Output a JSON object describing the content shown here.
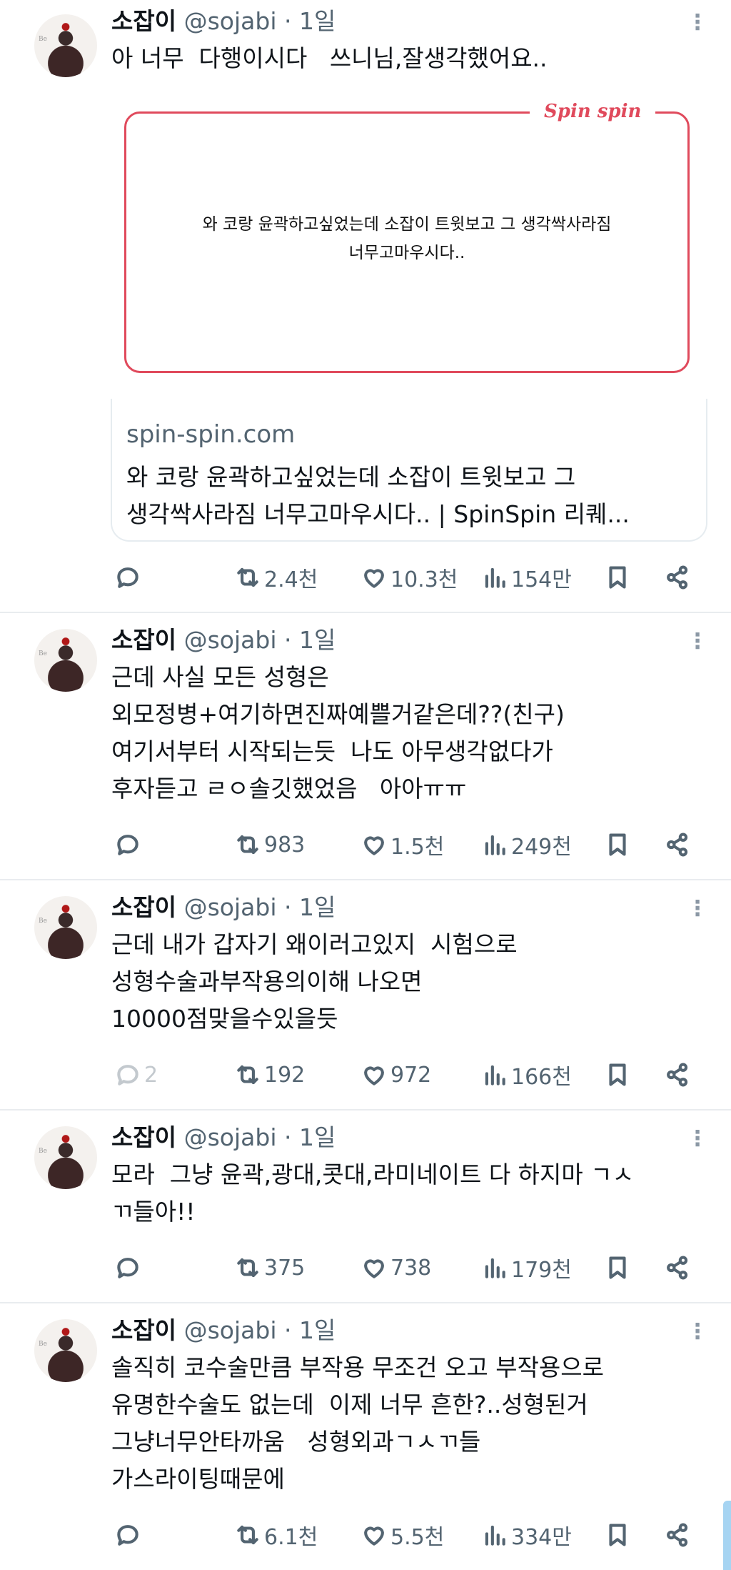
{
  "tweets": [
    {
      "name": "소잡이",
      "handle": "@sojabi",
      "time": "· 1일",
      "text": "아 너무  다행이시다   쓰니님,잘생각했어요..",
      "card": {
        "brand": "Spin spin",
        "quote_line1": "와 코랑 윤곽하고싶었는데 소잡이 트윗보고 그 생각싹사라짐",
        "quote_line2": "너무고마우시다..",
        "domain": "spin-spin.com",
        "title": "와 코랑 윤곽하고싶었는데 소잡이 트윗보고 그\n생각싹사라짐 너무고마우시다.. | SpinSpin 리퀘..."
      },
      "replies": "",
      "retweets": "2.4천",
      "likes": "10.3천",
      "views": "154만"
    },
    {
      "name": "소잡이",
      "handle": "@sojabi",
      "time": "· 1일",
      "text": "근데 사실 모든 성형은\n외모정병+여기하면진짜예쁠거같은데??(친구)\n여기서부터 시작되는듯  나도 아무생각없다가\n후자듣고 ㄹㅇ솔깃했었음   아아ㅠㅠ",
      "replies": "",
      "retweets": "983",
      "likes": "1.5천",
      "views": "249천"
    },
    {
      "name": "소잡이",
      "handle": "@sojabi",
      "time": "· 1일",
      "text": "근데 내가 갑자기 왜이러고있지  시험으로\n성형수술과부작용의이해 나오면\n10000점맞을수있을듯",
      "replies": "2",
      "retweets": "192",
      "likes": "972",
      "views": "166천"
    },
    {
      "name": "소잡이",
      "handle": "@sojabi",
      "time": "· 1일",
      "text": "모라  그냥 윤곽,광대,콧대,라미네이트 다 하지마 ㄱㅅ\nㄲ들아!!",
      "replies": "",
      "retweets": "375",
      "likes": "738",
      "views": "179천"
    },
    {
      "name": "소잡이",
      "handle": "@sojabi",
      "time": "· 1일",
      "text": "솔직히 코수술만큼 부작용 무조건 오고 부작용으로\n유명한수술도 없는데  이제 너무 흔한?..성형된거\n그냥너무안타까움   성형외과ㄱㅅㄲ들\n가스라이팅때문에",
      "replies": "",
      "retweets": "6.1천",
      "likes": "5.5천",
      "views": "334만"
    }
  ],
  "icons": {
    "reply": "reply-icon",
    "retweet": "retweet-icon",
    "like": "like-icon",
    "views": "views-icon",
    "bookmark": "bookmark-icon",
    "share": "share-icon",
    "more": "more-icon"
  },
  "colors": {
    "text": "#0f1419",
    "muted": "#536471",
    "card_accent": "#e04a5c",
    "divider": "#e9ecef",
    "scrollbar": "#a6d4f2"
  }
}
